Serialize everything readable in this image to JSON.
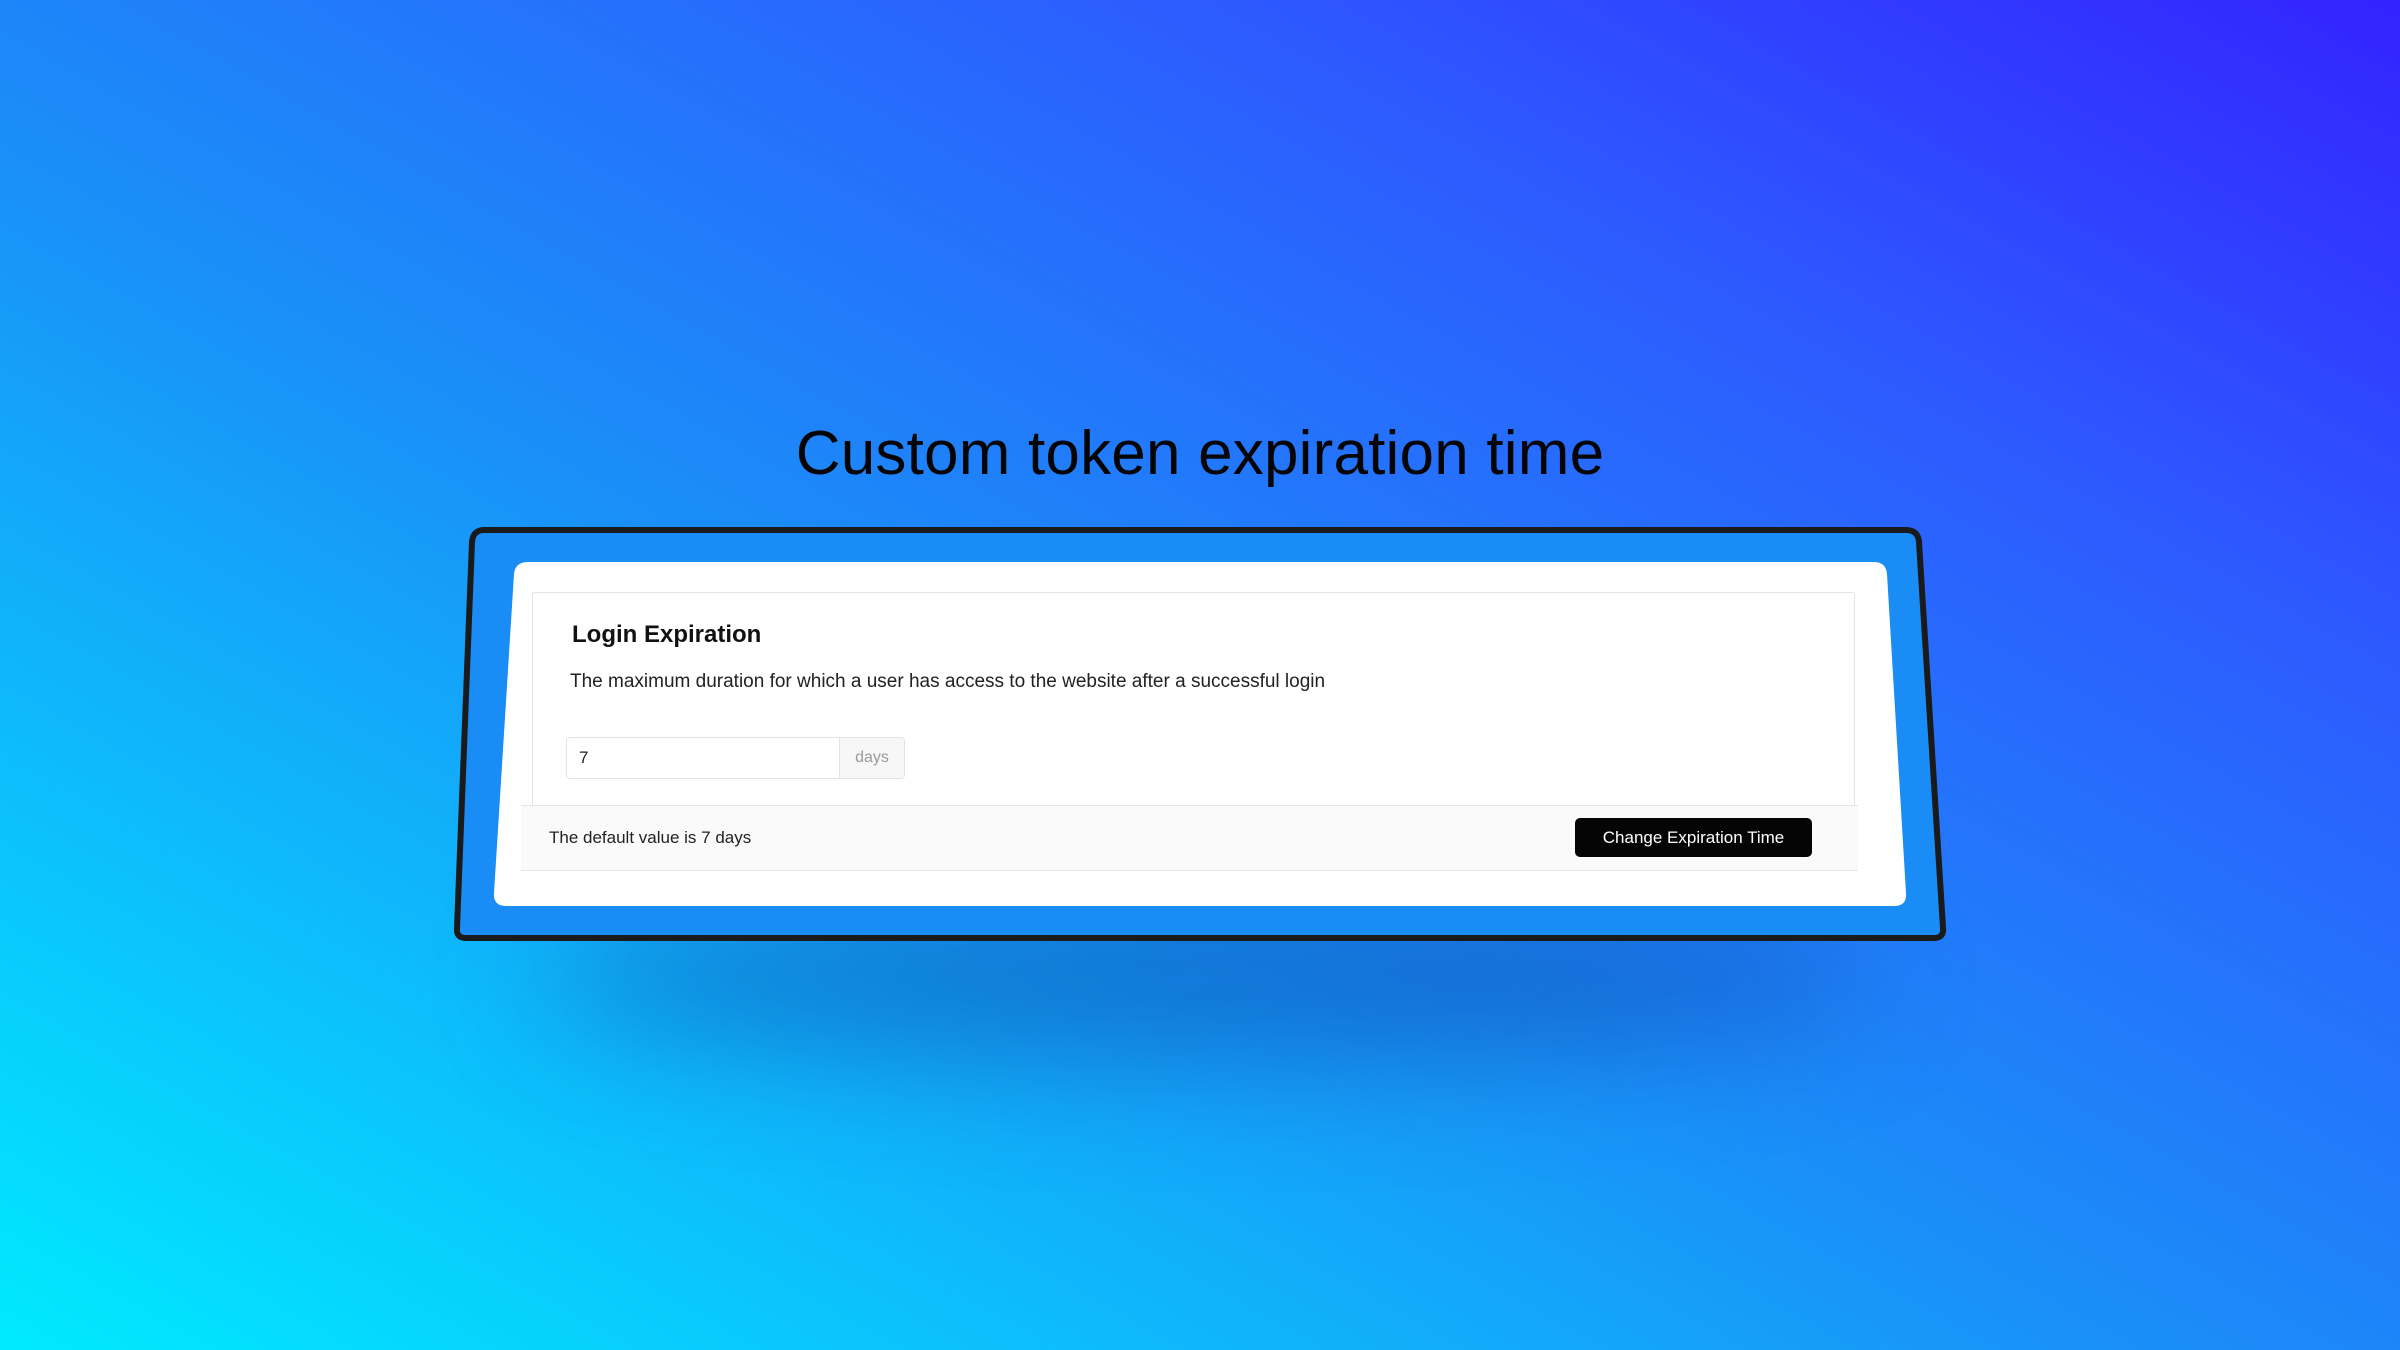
{
  "headline": "Custom token expiration time",
  "settings_card": {
    "title": "Login Expiration",
    "description": "The maximum duration for which a user has access to the website after a successful login",
    "duration_input": {
      "value": "7",
      "unit": "days"
    },
    "footer": {
      "note": "The default value is 7 days",
      "button_label": "Change Expiration Time"
    }
  },
  "colors": {
    "gradient_bottom_left": "#00eaff",
    "gradient_top_right": "#3323ff",
    "frame_stroke": "#1a1a1a",
    "card_background": "#ffffff",
    "button_background": "#050505"
  }
}
